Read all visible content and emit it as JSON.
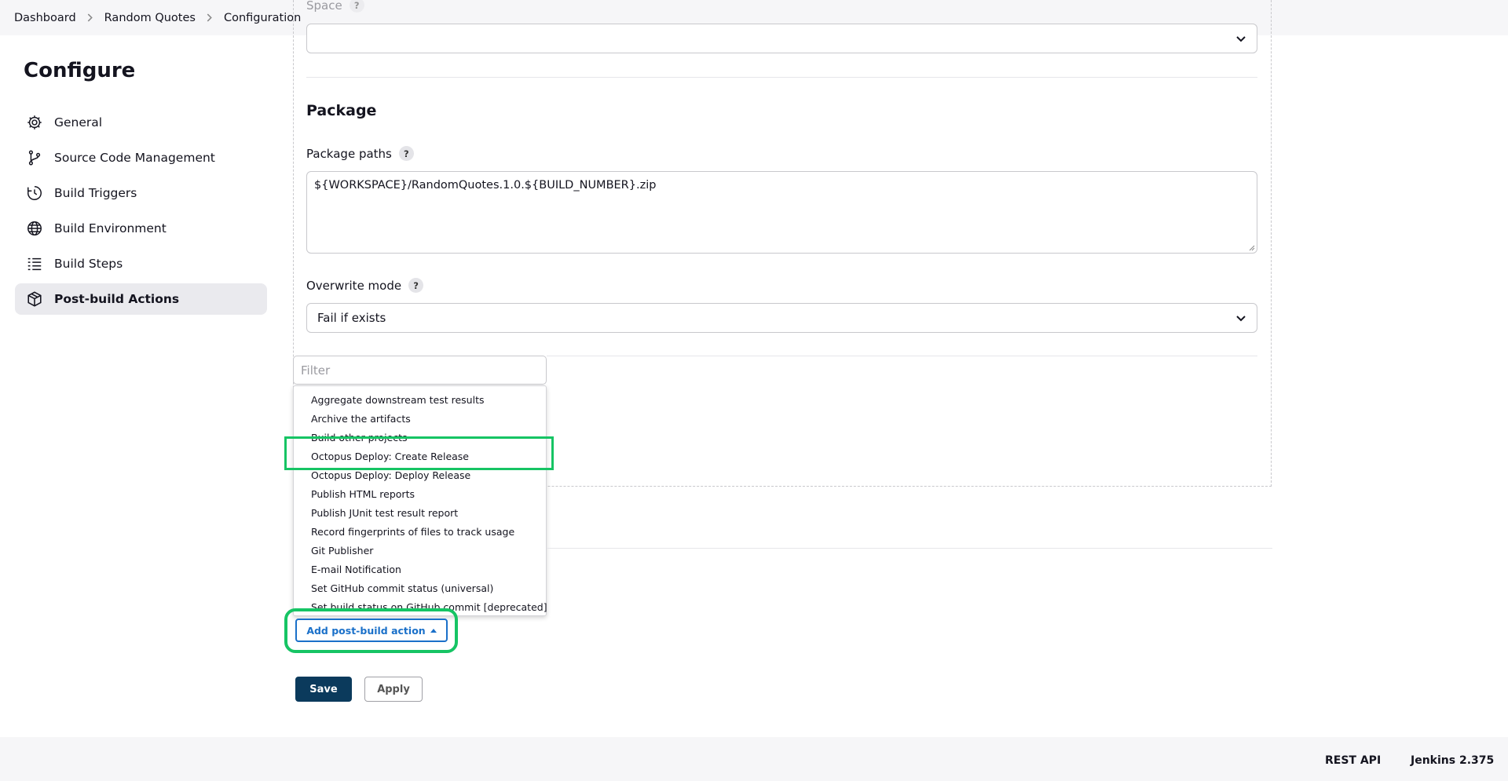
{
  "breadcrumbs": [
    "Dashboard",
    "Random Quotes",
    "Configuration"
  ],
  "page_title": "Configure",
  "sidebar": {
    "items": [
      {
        "label": "General",
        "icon": "gear-icon"
      },
      {
        "label": "Source Code Management",
        "icon": "branch-icon"
      },
      {
        "label": "Build Triggers",
        "icon": "clock-icon"
      },
      {
        "label": "Build Environment",
        "icon": "globe-icon"
      },
      {
        "label": "Build Steps",
        "icon": "list-icon"
      },
      {
        "label": "Post-build Actions",
        "icon": "cube-icon",
        "active": true
      }
    ]
  },
  "form": {
    "space_label": "Space",
    "space_value": "",
    "package_heading": "Package",
    "package_paths_label": "Package paths",
    "package_paths_value": "${WORKSPACE}/RandomQuotes.1.0.${BUILD_NUMBER}.zip",
    "overwrite_label": "Overwrite mode",
    "overwrite_value": "Fail if exists",
    "help_glyph": "?"
  },
  "dropdown": {
    "filter_placeholder": "Filter",
    "items": [
      "Aggregate downstream test results",
      "Archive the artifacts",
      "Build other projects",
      "Octopus Deploy: Create Release",
      "Octopus Deploy: Deploy Release",
      "Publish HTML reports",
      "Publish JUnit test result report",
      "Record fingerprints of files to track usage",
      "Git Publisher",
      "E-mail Notification",
      "Set GitHub commit status (universal)",
      "Set build status on GitHub commit [deprecated]"
    ],
    "highlighted_item": "Octopus Deploy: Create Release"
  },
  "buttons": {
    "add_post_build": "Add post-build action",
    "save": "Save",
    "apply": "Apply"
  },
  "footer": {
    "rest_api": "REST API",
    "version": "Jenkins 2.375"
  },
  "colors": {
    "highlight": "#16c464",
    "link_blue": "#1a70c9",
    "save_bg": "#0b3a5c"
  }
}
